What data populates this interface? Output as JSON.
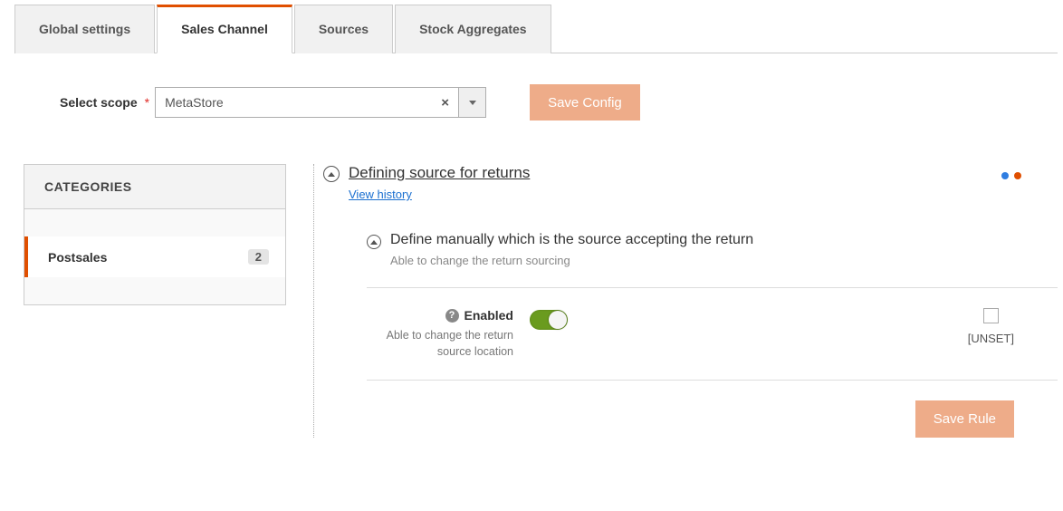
{
  "tabs": [
    {
      "label": "Global settings"
    },
    {
      "label": "Sales Channel"
    },
    {
      "label": "Sources"
    },
    {
      "label": "Stock Aggregates"
    }
  ],
  "scope": {
    "label": "Select scope",
    "value": "MetaStore"
  },
  "buttons": {
    "save_config": "Save Config",
    "save_rule": "Save Rule"
  },
  "sidebar": {
    "header": "CATEGORIES",
    "items": [
      {
        "label": "Postsales",
        "count": "2"
      }
    ]
  },
  "section": {
    "title": "Defining source for returns",
    "view_history": "View history",
    "sub_title": "Define manually which is the source accepting the return",
    "sub_desc": "Able to change the return sourcing",
    "field": {
      "label": "Enabled",
      "help": "Able to change the return source location"
    },
    "unset_label": "[UNSET]"
  }
}
